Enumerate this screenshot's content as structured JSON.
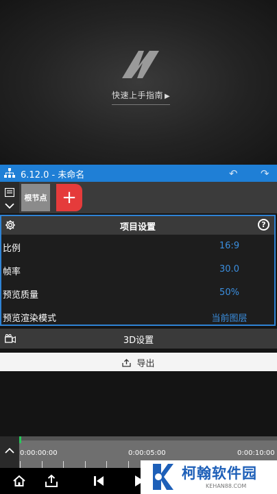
{
  "preview": {
    "guide_label": "快速上手指南",
    "guide_arrow": "▶"
  },
  "topbar": {
    "title": "6.12.0 - 未命名",
    "undo_icon": "undo-icon",
    "redo_icon": "redo-icon"
  },
  "nodes": {
    "root_label": "根节点",
    "add_label": "+"
  },
  "project_settings": {
    "title": "项目设置",
    "help": "?",
    "rows": [
      {
        "label": "比例",
        "value": "16:9"
      },
      {
        "label": "帧率",
        "value": "30.0"
      },
      {
        "label": "预览质量",
        "value": "50%"
      },
      {
        "label": "预览渲染模式",
        "value": "当前图层"
      }
    ]
  },
  "d3": {
    "label": "3D设置"
  },
  "export": {
    "label": "导出"
  },
  "timeline": {
    "timecodes": [
      "0:00:00:00",
      "0:00:05:00",
      "0:00:10:00"
    ]
  },
  "bottom_bar": {
    "icons": [
      "home-icon",
      "share-icon",
      "skip-back-icon",
      "play-icon"
    ]
  },
  "watermark": {
    "text": "柯翰软件园",
    "sub": "KEHAN88.COM"
  },
  "colors": {
    "accent": "#1f7fd6",
    "value_blue": "#3b8fe0",
    "add_red": "#e53b3b",
    "playhead": "#27c95a"
  }
}
